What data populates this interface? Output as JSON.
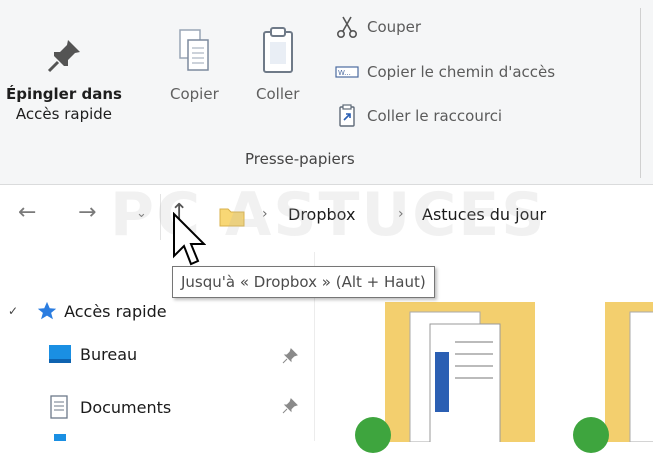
{
  "ribbon": {
    "pin_label_1": "Épingler dans",
    "pin_label_2": "Accès rapide",
    "copy_label": "Copier",
    "paste_label": "Coller",
    "cut_label": "Couper",
    "copy_path_label": "Copier le chemin d'accès",
    "paste_shortcut_label": "Coller le raccourci",
    "group_label": "Presse-papiers"
  },
  "navigation": {
    "breadcrumb": [
      "Dropbox",
      "Astuces du jour"
    ],
    "tooltip": "Jusqu'à « Dropbox » (Alt + Haut)"
  },
  "nav_pane": {
    "quick_access": "Accès rapide",
    "items": [
      {
        "label": "Bureau",
        "icon": "desktop-icon"
      },
      {
        "label": "Documents",
        "icon": "documents-icon"
      }
    ]
  },
  "watermark": "PC ASTUCES",
  "colors": {
    "accent": "#0078d7",
    "folder": "#f8d775",
    "quick_access_star": "#2b7de0"
  }
}
